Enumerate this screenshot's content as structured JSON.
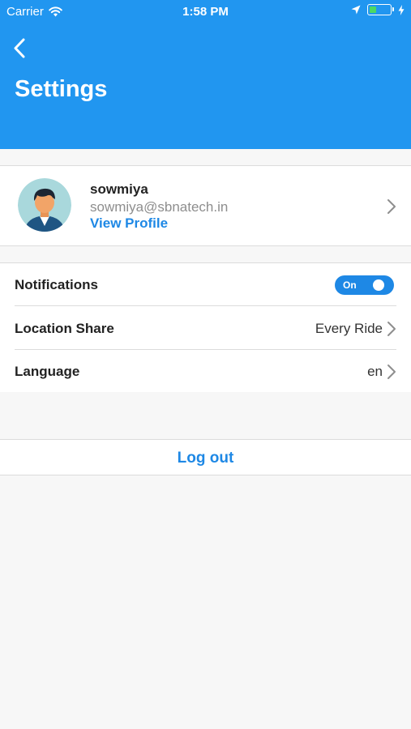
{
  "status_bar": {
    "carrier": "Carrier",
    "time": "1:58 PM",
    "icons": [
      "wifi-icon",
      "location-arrow-icon",
      "battery-icon",
      "charging-bolt-icon"
    ],
    "battery_level": 0.3
  },
  "header": {
    "back_icon": "chevron-left-icon",
    "title": "Settings",
    "background": "#2196f0"
  },
  "profile": {
    "name": "sowmiya",
    "email": "sowmiya@sbnatech.in",
    "link_label": "View Profile",
    "avatar_icon": "user-avatar-icon",
    "link_color": "#1e88e5"
  },
  "settings": {
    "notifications": {
      "label": "Notifications",
      "toggle_label": "On",
      "enabled": true
    },
    "location_share": {
      "label": "Location Share",
      "value": "Every Ride"
    },
    "language": {
      "label": "Language",
      "value": "en"
    }
  },
  "logout": {
    "label": "Log out"
  }
}
